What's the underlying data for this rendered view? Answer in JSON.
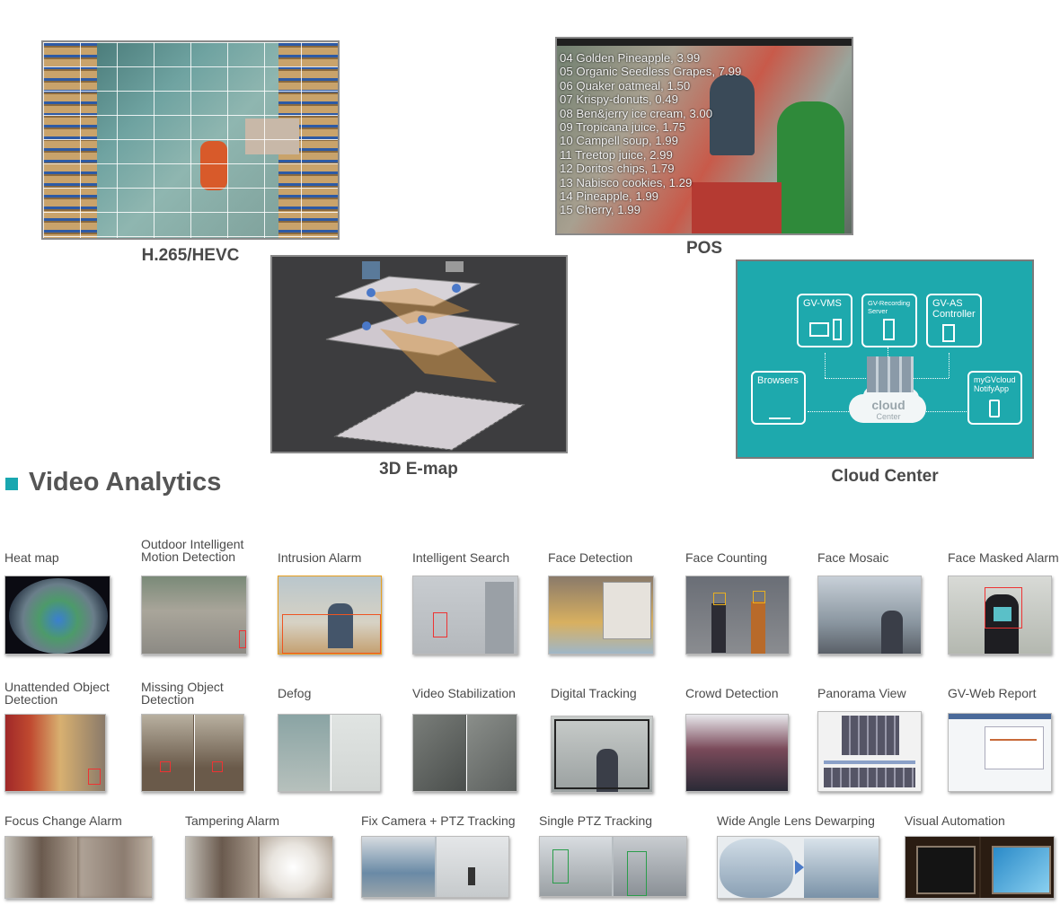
{
  "features": {
    "h265": "H.265/HEVC",
    "pos": "POS",
    "emap": "3D E-map",
    "cloud": "Cloud Center"
  },
  "pos_list": [
    "04 Golden Pineapple, 3.99",
    "05 Organic Seedless Grapes, 7.99",
    "06 Quaker oatmeal, 1.50",
    "07 Krispy-donuts, 0.49",
    "08 Ben&jerry ice cream, 3.00",
    "09 Tropicana juice, 1.75",
    "10 Campell soup, 1.99",
    "11 Treetop juice, 2.99",
    "12 Doritos chips, 1.79",
    "13 Nabisco cookies, 1.29",
    "14 Pineapple, 1.99",
    "15 Cherry, 1.99"
  ],
  "cloud_diagram": {
    "gv_vms": "GV-VMS",
    "gv_recording_line1": "GV-Recording",
    "gv_recording_line2": "Server",
    "gv_as_line1": "GV-AS",
    "gv_as_line2": "Controller",
    "browsers": "Browsers",
    "mygv_line1": "myGVcloud",
    "mygv_line2": "NotifyApp",
    "cloud_word": "cloud",
    "center_word": "Center"
  },
  "section_title": "Video Analytics",
  "row1": [
    {
      "line1": "Heat map",
      "line2": ""
    },
    {
      "line1": "Outdoor Intelligent",
      "line2": "Motion Detection"
    },
    {
      "line1": "Intrusion Alarm",
      "line2": ""
    },
    {
      "line1": "Intelligent Search",
      "line2": ""
    },
    {
      "line1": "Face Detection",
      "line2": ""
    },
    {
      "line1": "Face Counting",
      "line2": ""
    },
    {
      "line1": "Face Mosaic",
      "line2": ""
    },
    {
      "line1": "Face Masked Alarm",
      "line2": ""
    }
  ],
  "row2": [
    {
      "line1": "Unattended Object",
      "line2": "Detection"
    },
    {
      "line1": "Missing Object",
      "line2": "Detection"
    },
    {
      "line1": "Defog",
      "line2": ""
    },
    {
      "line1": "Video Stabilization",
      "line2": ""
    },
    {
      "line1": "Digital Tracking",
      "line2": ""
    },
    {
      "line1": "Crowd Detection",
      "line2": ""
    },
    {
      "line1": "Panorama View",
      "line2": ""
    },
    {
      "line1": "GV-Web Report",
      "line2": ""
    }
  ],
  "row3": [
    {
      "line1": "Focus Change Alarm"
    },
    {
      "line1": "Tampering Alarm"
    },
    {
      "line1": "Fix Camera + PTZ Tracking"
    },
    {
      "line1": "Single PTZ Tracking"
    },
    {
      "line1": "Wide Angle Lens Dewarping"
    },
    {
      "line1": "Visual Automation"
    }
  ],
  "colors": {
    "accent": "#19a7b0",
    "cloud_bg": "#1ea9ad",
    "alarm_box": "#ee3333"
  }
}
